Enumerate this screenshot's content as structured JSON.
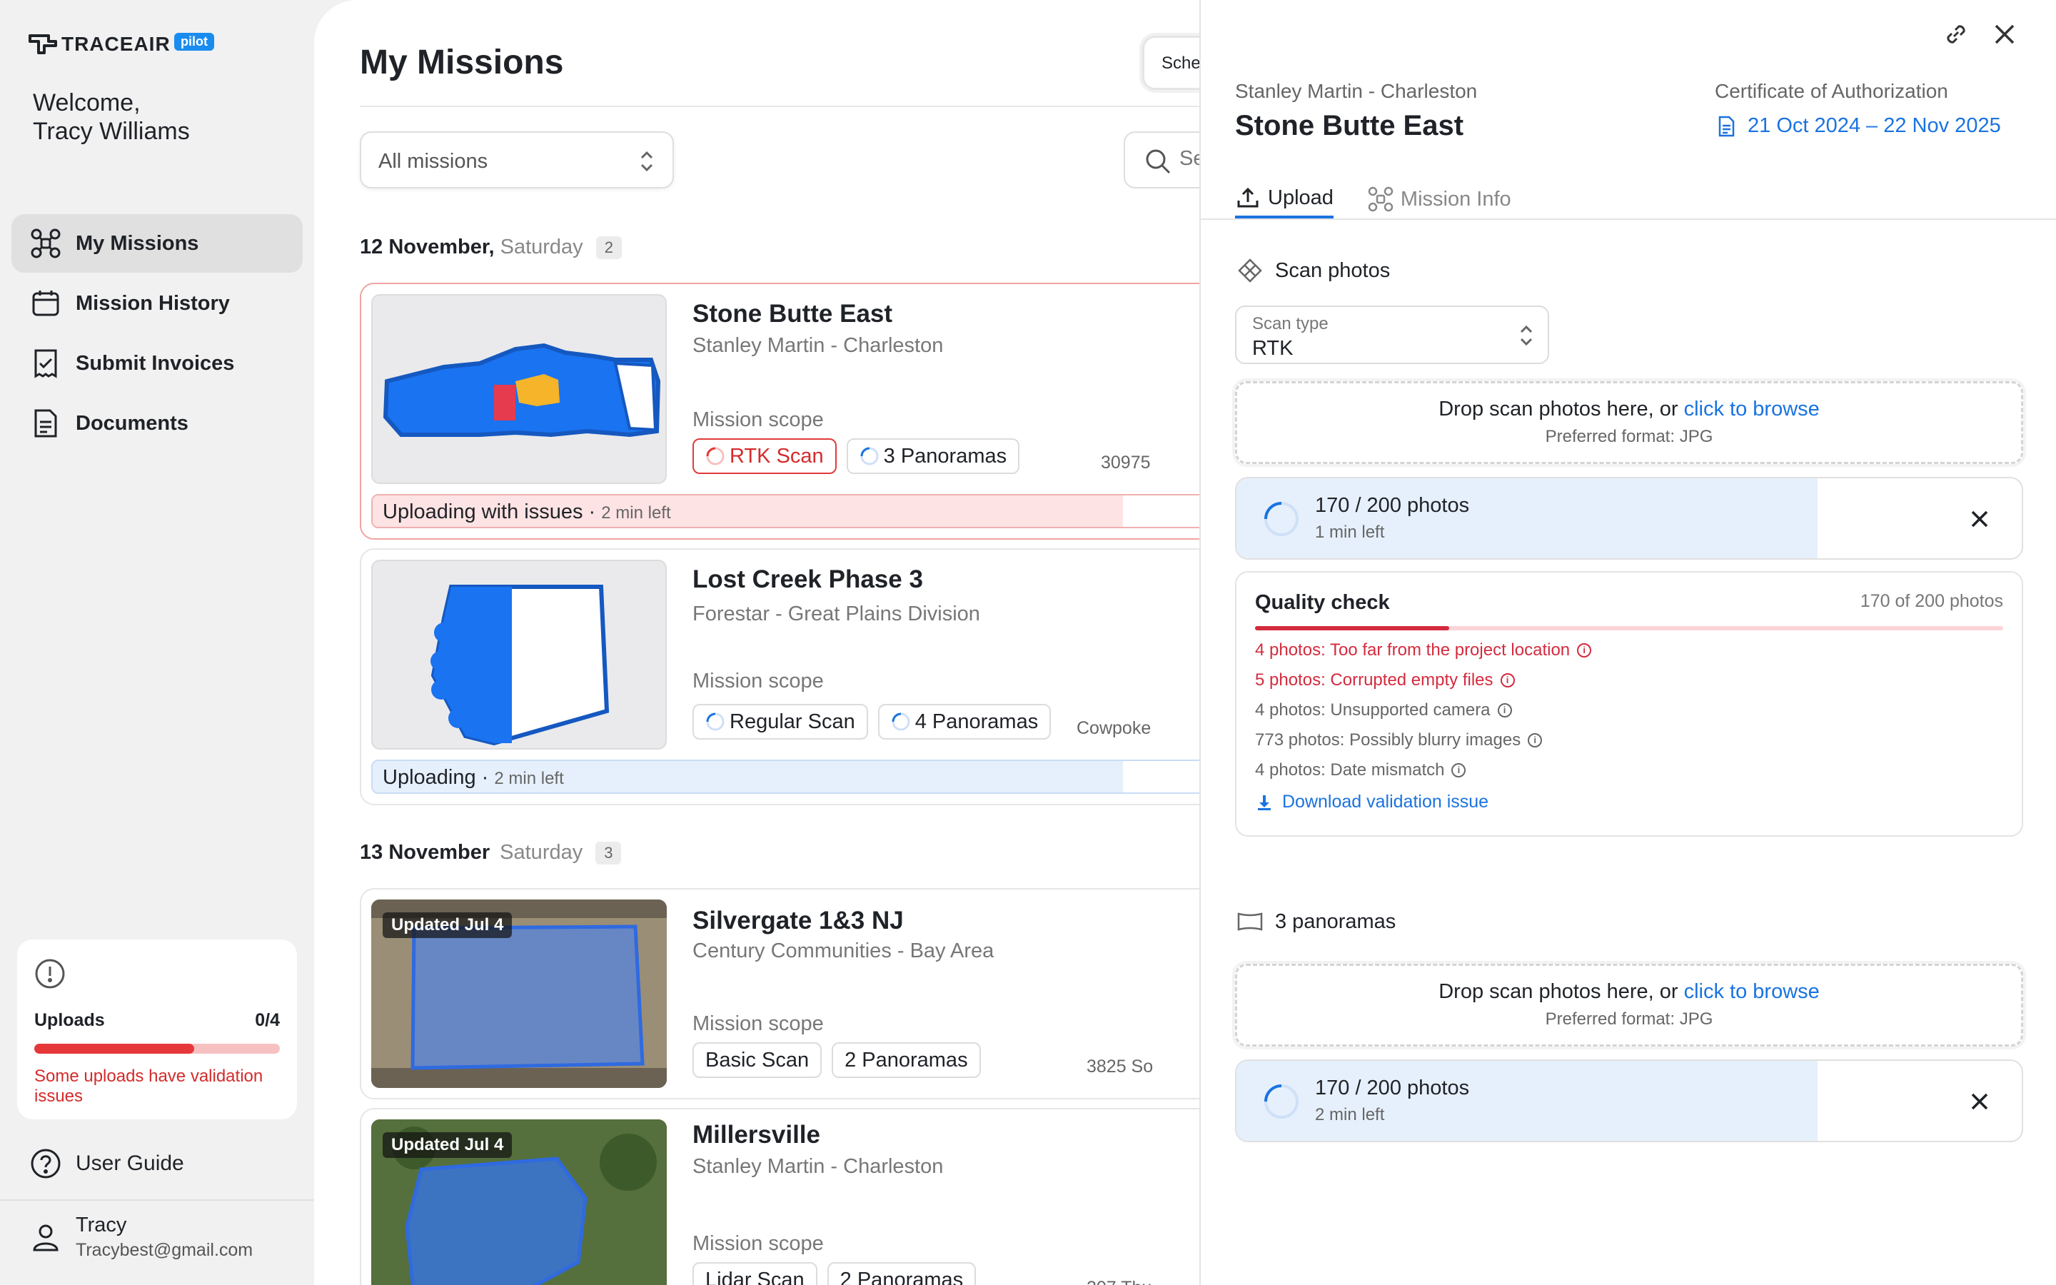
{
  "brand": {
    "name": "TRACEAIR",
    "badge": "pilot"
  },
  "welcome": {
    "line1": "Welcome,",
    "line2": "Tracy Williams"
  },
  "nav": [
    {
      "label": "My Missions",
      "icon": "drone-icon",
      "active": true
    },
    {
      "label": "Mission History",
      "icon": "calendar-icon"
    },
    {
      "label": "Submit Invoices",
      "icon": "receipt-icon"
    },
    {
      "label": "Documents",
      "icon": "document-icon"
    }
  ],
  "uploads_card": {
    "label": "Uploads",
    "count": "0/4",
    "progress": 0.65,
    "message": "Some uploads have validation issues"
  },
  "user_guide": "User Guide",
  "user": {
    "name": "Tracy",
    "email": "Tracybest@gmail.com"
  },
  "main": {
    "title": "My Missions",
    "schedule_btn": "Sche",
    "filter": "All missions",
    "search_placeholder": "Se"
  },
  "groups": [
    {
      "date": "12 November,",
      "day": "Saturday",
      "count": "2"
    },
    {
      "date": "13 November",
      "day": "Saturday",
      "count": "3"
    }
  ],
  "missions": [
    {
      "title": "Stone Butte East",
      "sub": "Stanley Martin - Charleston",
      "scope_label": "Mission scope",
      "chips": [
        "RTK Scan",
        "3 Panoramas"
      ],
      "addr": "30975",
      "status": "Uploading with issues",
      "status_time": "2 min left",
      "progress": 0.85
    },
    {
      "title": "Lost Creek Phase 3",
      "sub": "Forestar - Great Plains Division",
      "scope_label": "Mission scope",
      "chips": [
        "Regular Scan",
        "4 Panoramas"
      ],
      "addr": "Cowpoke",
      "status": "Uploading",
      "status_time": "2 min left",
      "progress": 0.85
    },
    {
      "title": "Silvergate 1&3 NJ",
      "sub": "Century Communities - Bay Area",
      "scope_label": "Mission scope",
      "chips": [
        "Basic Scan",
        "2 Panoramas"
      ],
      "addr": "3825 So",
      "badge": "Updated Jul 4"
    },
    {
      "title": "Millersville",
      "sub": "Stanley Martin - Charleston",
      "scope_label": "Mission scope",
      "chips": [
        "Lidar Scan",
        "2 Panoramas"
      ],
      "addr": "207 Thu",
      "badge": "Updated Jul 4"
    }
  ],
  "panel": {
    "sub": "Stanley Martin - Charleston",
    "title": "Stone Butte East",
    "cert_label": "Certificate of Authorization",
    "cert_dates": "21 Oct 2024 – 22 Nov 2025",
    "tabs": [
      "Upload",
      "Mission Info"
    ],
    "scan_section": "Scan photos",
    "scan_type_label": "Scan type",
    "scan_type_value": "RTK",
    "drop_text": "Drop scan photos here, or ",
    "drop_link": "click to browse",
    "drop_format": "Preferred format: JPG",
    "upload1": {
      "count": "170 / 200 photos",
      "time": "1 min left",
      "progress": 0.74
    },
    "quality": {
      "title": "Quality check",
      "count": "170 of 200 photos",
      "progress": 0.26,
      "issues": [
        {
          "text": "4 photos: Too far from the project location",
          "error": true
        },
        {
          "text": "5 photos: Corrupted empty files",
          "error": true
        },
        {
          "text": "4 photos: Unsupported camera",
          "error": false
        },
        {
          "text": "773 photos: Possibly blurry images",
          "error": false
        },
        {
          "text": "4 photos: Date mismatch",
          "error": false
        }
      ],
      "download": "Download validation issue"
    },
    "pano_section": "3 panoramas",
    "upload2": {
      "count": "170 / 200 photos",
      "time": "2 min left",
      "progress": 0.74
    }
  }
}
